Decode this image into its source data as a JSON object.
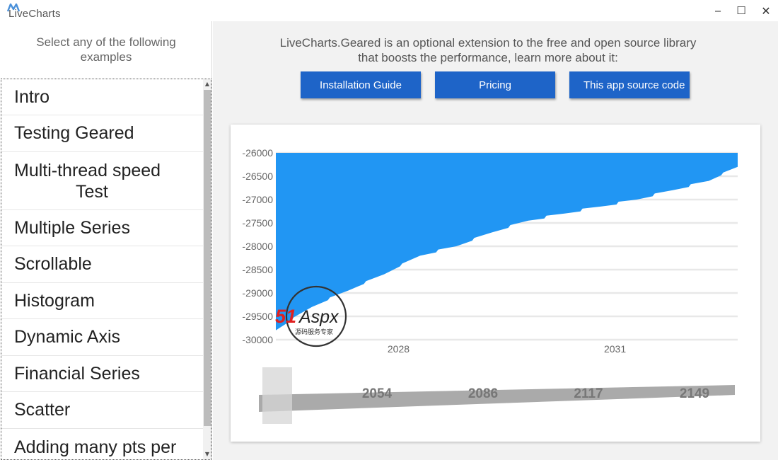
{
  "window": {
    "title": "LiveCharts",
    "minimize_glyph": "‒",
    "maximize_glyph": "☐",
    "close_glyph": "✕"
  },
  "sidebar": {
    "header": "Select any of the following examples",
    "items": [
      {
        "label": "Intro"
      },
      {
        "label": "Testing Geared"
      },
      {
        "label": "Multi-thread speed",
        "label_line2": "Test"
      },
      {
        "label": "Multiple Series"
      },
      {
        "label": "Scrollable"
      },
      {
        "label": "Histogram"
      },
      {
        "label": "Dynamic Axis"
      },
      {
        "label": "Financial Series"
      },
      {
        "label": "Scatter"
      },
      {
        "label": "Adding many pts per"
      }
    ],
    "scroll_up_glyph": "▲",
    "scroll_down_glyph": "▼"
  },
  "main": {
    "intro_line1": "LiveCharts.Geared is an optional extension to the free and open source library",
    "intro_line2": "that boosts the performance, learn more about it:",
    "buttons": {
      "installation": "Installation Guide",
      "pricing": "Pricing",
      "source": "This app source code"
    }
  },
  "colors": {
    "accent": "#1e64c8",
    "series_fill": "#2196f3",
    "scroller_fill": "#aaaaaa"
  },
  "watermark": {
    "brand": "51Aspx",
    "tagline": "源码服务专家"
  },
  "chart_data": {
    "type": "area",
    "main_chart": {
      "y_ticks": [
        -26000,
        -26500,
        -27000,
        -27500,
        -28000,
        -28500,
        -29000,
        -29500,
        -30000
      ],
      "ylim": [
        -30000,
        -26000
      ],
      "x_ticks": [
        "2028",
        "2031"
      ],
      "xlim": [
        2026.3,
        2032.7
      ],
      "grid": true,
      "series": [
        {
          "x": [
            2026.3,
            2026.8,
            2027.3,
            2027.8,
            2028.3,
            2028.8,
            2029.3,
            2029.8,
            2030.3,
            2030.8,
            2031.3,
            2031.8,
            2032.3,
            2032.7
          ],
          "values": [
            -29800,
            -29300,
            -28950,
            -28600,
            -28200,
            -28000,
            -27700,
            -27450,
            -27300,
            -27150,
            -27000,
            -26800,
            -26600,
            -26300
          ]
        }
      ]
    },
    "scroller": {
      "x_ticks": [
        "2054",
        "2086",
        "2117",
        "2149"
      ]
    }
  }
}
